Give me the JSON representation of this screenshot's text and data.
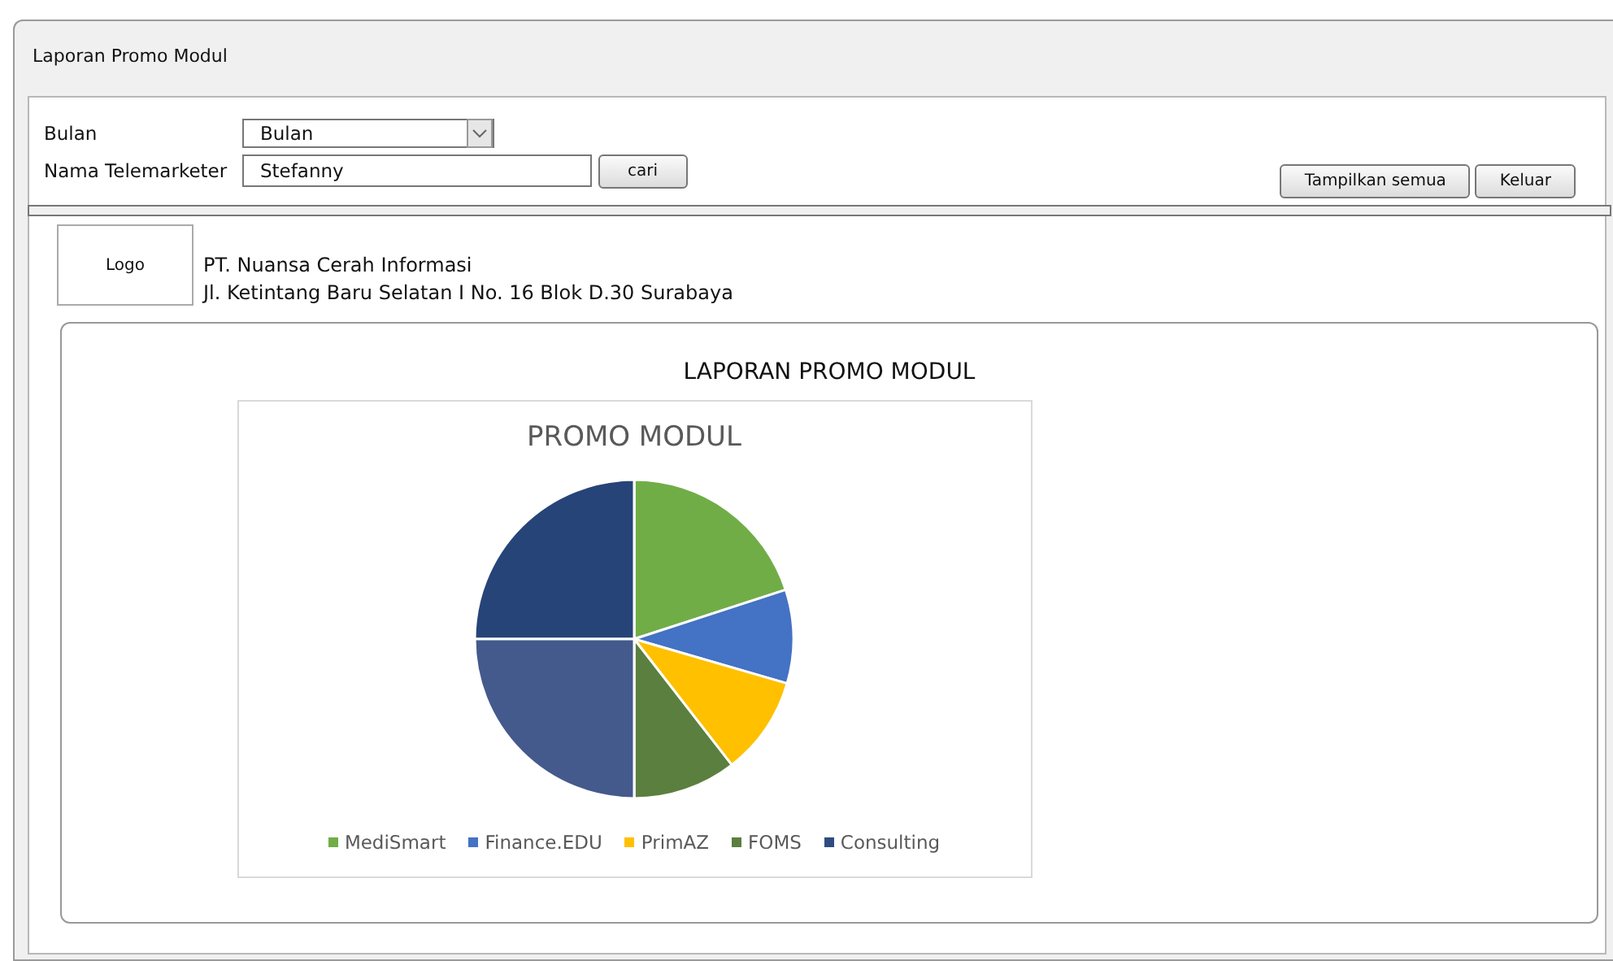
{
  "window": {
    "title": "Laporan Promo Modul"
  },
  "filters": [
    {
      "kind": "dropdown",
      "label": "Bulan",
      "value": "Bulan"
    },
    {
      "kind": "text",
      "label": "Nama Telemarketer",
      "value": "Stefanny",
      "button": "cari"
    }
  ],
  "buttons": [
    "Tampilkan semua",
    "Keluar"
  ],
  "header": {
    "logo": "Logo",
    "company": "PT. Nuansa Cerah Informasi",
    "address": "Jl. Ketintang Baru Selatan I No. 16 Blok D.30 Surabaya"
  },
  "report": {
    "title": "LAPORAN PROMO MODUL",
    "chart_title": "PROMO MODUL",
    "legend": [
      {
        "name": "MediSmart",
        "color": "#70ad47"
      },
      {
        "name": "Finance.EDU",
        "color": "#4472c4"
      },
      {
        "name": "PrimAZ",
        "color": "#ffc000"
      },
      {
        "name": "FOMS",
        "color": "#5b7f3f"
      },
      {
        "name": "Consulting",
        "color": "#2f4b80"
      }
    ]
  }
}
